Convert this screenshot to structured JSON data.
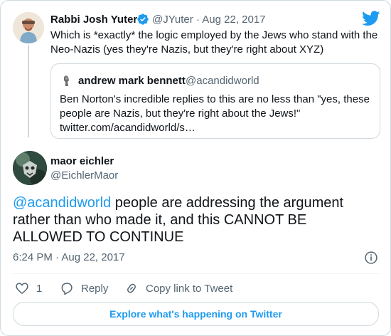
{
  "parent_tweet": {
    "author_name": "Rabbi Josh Yuter",
    "author_handle": "@JYuter",
    "separator": "·",
    "date": "Aug 22, 2017",
    "text": "Which is *exactly* the logic employed by the Jews who stand with the Neo-Nazis (yes they're Nazis, but they're right about XYZ)"
  },
  "quoted_tweet": {
    "author_name": "andrew mark bennett",
    "author_handle": "@acandidworld",
    "text_lines": [
      "Ben Norton's incredible replies to this are no less than \"yes, these",
      "people are Nazis, but they're right about the Jews!\"",
      "twitter.com/acandidworld/s…"
    ]
  },
  "main_tweet": {
    "author_name": "maor eichler",
    "author_handle": "@EichlerMaor",
    "mention": "@acandidworld",
    "text_line1_rest": " people are addressing the argument",
    "text_line2": "rather than who made it, and this CANNOT BE",
    "text_line3": "ALLOWED TO CONTINUE",
    "timestamp": "6:24 PM · Aug 22, 2017"
  },
  "actions": {
    "like_count": "1",
    "reply_label": "Reply",
    "copy_link_label": "Copy link to Tweet"
  },
  "footer": {
    "explore_label": "Explore what's happening on Twitter"
  },
  "colors": {
    "accent": "#1d9bf0",
    "secondary_text": "#536471",
    "border": "#cfd9de"
  }
}
